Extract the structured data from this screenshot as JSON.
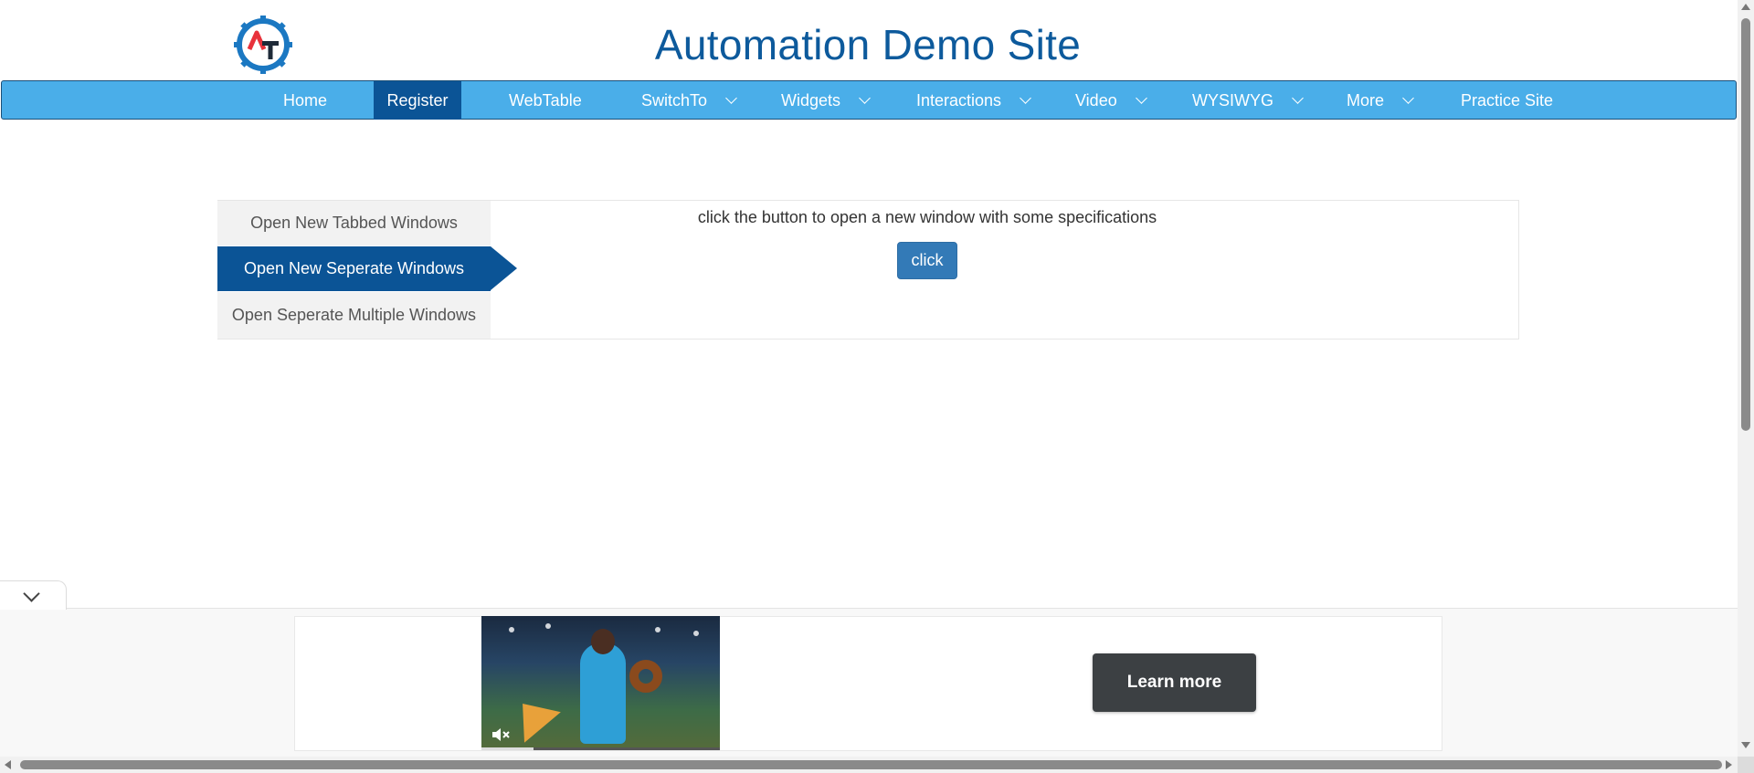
{
  "header": {
    "site_title": "Automation Demo Site",
    "logo_icon": "gear-at-logo",
    "logo_colors": {
      "gear": "#1b78c2",
      "letter_a": "#e8323c",
      "letter_t": "#1e2a38"
    }
  },
  "nav": {
    "items": [
      {
        "label": "Home",
        "has_dropdown": false,
        "active": false
      },
      {
        "label": "Register",
        "has_dropdown": false,
        "active": true
      },
      {
        "label": "WebTable",
        "has_dropdown": false,
        "active": false
      },
      {
        "label": "SwitchTo",
        "has_dropdown": true,
        "active": false
      },
      {
        "label": "Widgets",
        "has_dropdown": true,
        "active": false
      },
      {
        "label": "Interactions",
        "has_dropdown": true,
        "active": false
      },
      {
        "label": "Video",
        "has_dropdown": true,
        "active": false
      },
      {
        "label": "WYSIWYG",
        "has_dropdown": true,
        "active": false
      },
      {
        "label": "More",
        "has_dropdown": true,
        "active": false
      },
      {
        "label": "Practice Site",
        "has_dropdown": false,
        "active": false
      }
    ],
    "bar_color": "#4aaee9",
    "active_color": "#0b5496"
  },
  "windows": {
    "tabs": [
      {
        "label": "Open New Tabbed Windows",
        "active": false
      },
      {
        "label": "Open New Seperate Windows",
        "active": true
      },
      {
        "label": "Open Seperate Multiple Windows",
        "active": false
      }
    ],
    "instruction": "click the button to open a new window with some specifications",
    "button_label": "click",
    "button_color": "#337ab7"
  },
  "ad": {
    "toggle_icon": "chevron-down-icon",
    "video_mute_icon": "muted-speaker-icon",
    "video_progress": 0.22,
    "cta_label": "Learn more"
  }
}
